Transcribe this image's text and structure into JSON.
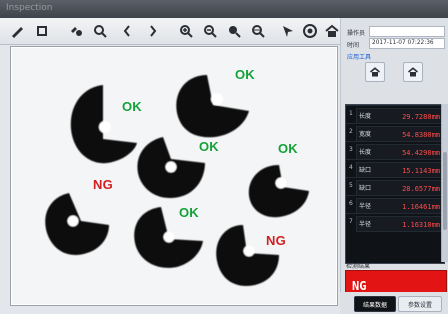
{
  "window": {
    "title": "Inspection"
  },
  "toolbar": {
    "icons": [
      "pen-icon",
      "file-icon",
      "tool-icon",
      "zoom-icon",
      "hand-left-icon",
      "hand-right-icon",
      "zoom-in-icon",
      "zoom-out-icon",
      "zoom-fit-icon",
      "zoom-reset-icon",
      "pointer-icon",
      "record-icon",
      "home-icon"
    ]
  },
  "canvas": {
    "labels": {
      "ok1": "OK",
      "ok2": "OK",
      "ok3": "OK",
      "ok4": "OK",
      "ok5": "OK",
      "ng1": "NG",
      "ng2": "NG"
    }
  },
  "panel": {
    "fields": {
      "f1": "操作员",
      "f2": "时间",
      "time_value": "2017-11-07 07:22:36"
    },
    "section_title": "应用工具",
    "rows": [
      {
        "index": "1",
        "name": "长度",
        "value": "29.7280mm"
      },
      {
        "index": "2",
        "name": "宽度",
        "value": "54.8380mm"
      },
      {
        "index": "3",
        "name": "长度",
        "value": "54.4290mm"
      },
      {
        "index": "4",
        "name": "缺口",
        "value": "15.1143mm"
      },
      {
        "index": "5",
        "name": "缺口",
        "value": "28.6577mm"
      },
      {
        "index": "6",
        "name": "半径",
        "value": "1.16461mm"
      },
      {
        "index": "7",
        "name": "半径",
        "value": "1.16310mm"
      }
    ],
    "status": {
      "label": "检测结果",
      "value": "NG"
    },
    "tabs": {
      "left": "结果数据",
      "right": "参数设置"
    }
  },
  "colors": {
    "ok": "#15a13a",
    "ng": "#d11f1f",
    "status_bg": "#e21414"
  }
}
